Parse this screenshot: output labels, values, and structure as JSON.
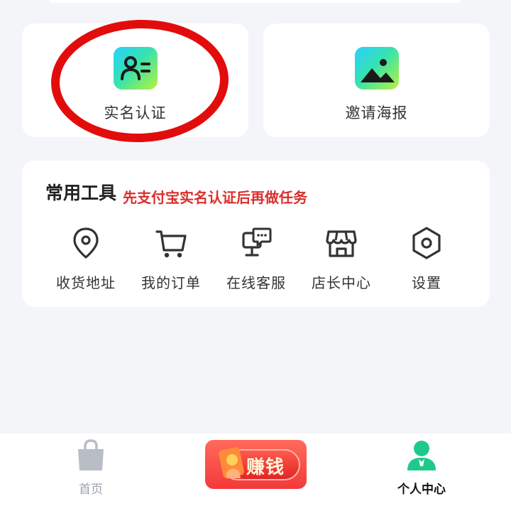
{
  "cards": {
    "realname": {
      "label": "实名认证",
      "icon": "id-card-icon"
    },
    "invite": {
      "label": "邀请海报",
      "icon": "image-poster-icon"
    }
  },
  "tools": {
    "title": "常用工具",
    "items": [
      {
        "label": "收货地址",
        "icon": "location-pin-icon"
      },
      {
        "label": "我的订单",
        "icon": "shopping-cart-icon"
      },
      {
        "label": "在线客服",
        "icon": "chat-monitor-icon"
      },
      {
        "label": "店长中心",
        "icon": "store-icon"
      },
      {
        "label": "设置",
        "icon": "gear-hex-icon"
      }
    ]
  },
  "annotation": {
    "text": "先支付宝实名认证后再做任务"
  },
  "bottom_nav": {
    "home": {
      "label": "首页",
      "icon": "shopping-bag-icon"
    },
    "earn": {
      "label": "赚钱"
    },
    "me": {
      "label": "个人中心",
      "icon": "person-icon"
    }
  },
  "colors": {
    "background": "#f4f5f9",
    "accent_green": "#1fc98c",
    "annotation_red": "#d8302c"
  }
}
